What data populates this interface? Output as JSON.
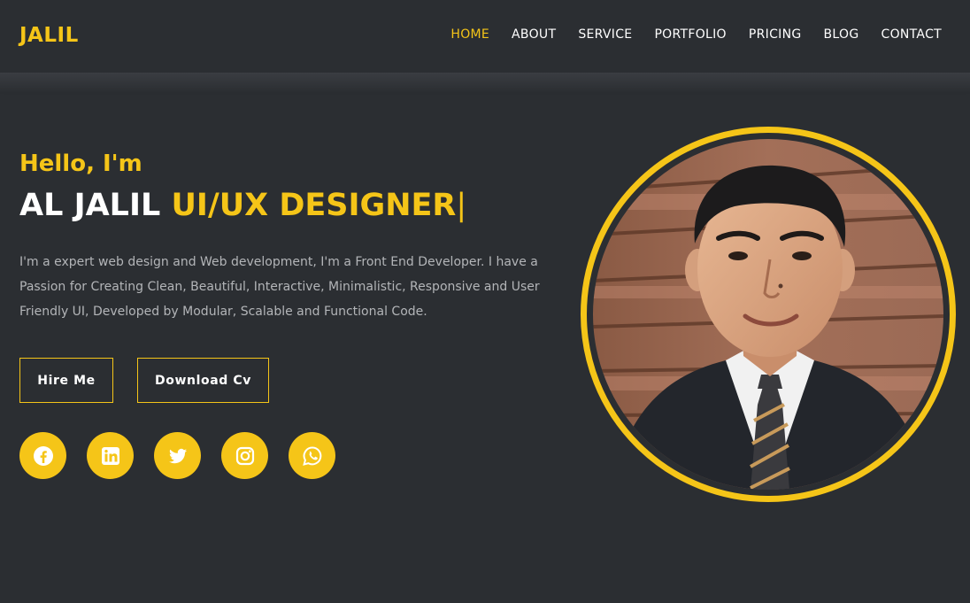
{
  "brand": {
    "logo": "JALIL",
    "accent": "#f5c518",
    "background": "#2b2e32"
  },
  "nav": {
    "items": [
      {
        "label": "HOME",
        "active": true
      },
      {
        "label": "ABOUT",
        "active": false
      },
      {
        "label": "SERVICE",
        "active": false
      },
      {
        "label": "PORTFOLIO",
        "active": false
      },
      {
        "label": "PRICING",
        "active": false
      },
      {
        "label": "BLOG",
        "active": false
      },
      {
        "label": "CONTACT",
        "active": false
      }
    ]
  },
  "hero": {
    "greeting": "Hello, I'm",
    "name": "AL JALIL",
    "role": "UI/UX DESIGNER",
    "cursor": "|",
    "bio": "I'm a expert web design and Web development, I'm a Front End Developer. I have a Passion for Creating Clean, Beautiful, Interactive, Minimalistic, Responsive and User Friendly UI, Developed by Modular, Scalable and Functional Code.",
    "buttons": {
      "hire": "Hire Me",
      "download": "Download Cv"
    },
    "socials": [
      "facebook-icon",
      "linkedin-icon",
      "twitter-icon",
      "instagram-icon",
      "whatsapp-icon"
    ]
  }
}
